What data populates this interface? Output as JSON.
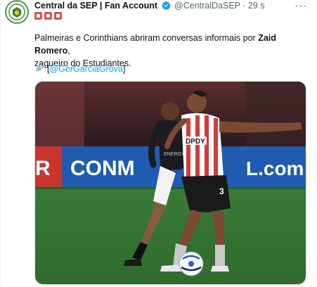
{
  "tweet": {
    "display_name": "Central da SEP | Fan Account",
    "handle": "@CentralDaSEP",
    "separator": "·",
    "time": "29 s",
    "more_label": "···",
    "flags_icon": "red-flag-emoji",
    "text_part1": "Palmeiras e Corinthians abriram conversas informais por ",
    "text_bold": "Zaid Romero",
    "text_part2": ",",
    "text_line2": "zagueiro do Estudiantes.",
    "credit_open": "[",
    "credit_mention": "@GerGarciaGrova",
    "credit_close": "]"
  },
  "photo": {
    "banner_left": "R",
    "banner_main": "CONM",
    "banner_right": "L.com",
    "shirt_text": "ENERGY",
    "sponsor": "DPDY",
    "player_number": "3"
  },
  "colors": {
    "link": "#1d9bf0",
    "verified": "#1d9bf0",
    "secondary": "#536471",
    "pitch": "#3c7a36",
    "banner_blue": "#1f5bb0",
    "stripe_red": "#d33a3a"
  }
}
